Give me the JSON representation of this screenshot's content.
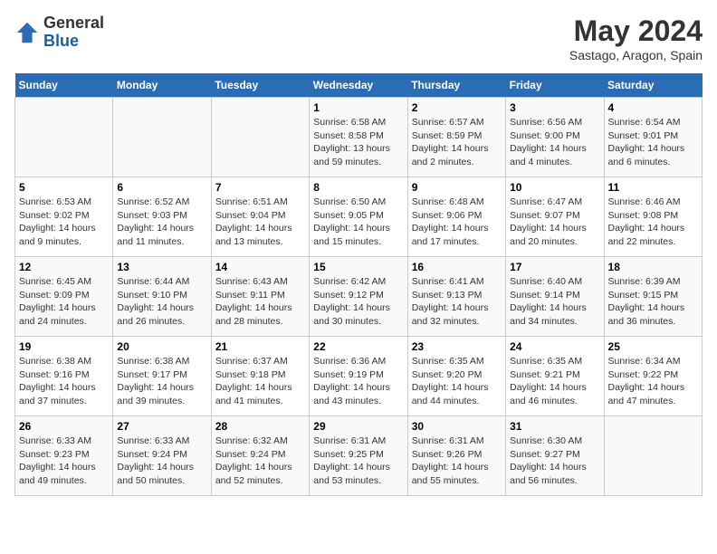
{
  "header": {
    "logo_line1": "General",
    "logo_line2": "Blue",
    "month": "May 2024",
    "location": "Sastago, Aragon, Spain"
  },
  "weekdays": [
    "Sunday",
    "Monday",
    "Tuesday",
    "Wednesday",
    "Thursday",
    "Friday",
    "Saturday"
  ],
  "weeks": [
    [
      {
        "day": "",
        "content": ""
      },
      {
        "day": "",
        "content": ""
      },
      {
        "day": "",
        "content": ""
      },
      {
        "day": "1",
        "content": "Sunrise: 6:58 AM\nSunset: 8:58 PM\nDaylight: 13 hours and 59 minutes."
      },
      {
        "day": "2",
        "content": "Sunrise: 6:57 AM\nSunset: 8:59 PM\nDaylight: 14 hours and 2 minutes."
      },
      {
        "day": "3",
        "content": "Sunrise: 6:56 AM\nSunset: 9:00 PM\nDaylight: 14 hours and 4 minutes."
      },
      {
        "day": "4",
        "content": "Sunrise: 6:54 AM\nSunset: 9:01 PM\nDaylight: 14 hours and 6 minutes."
      }
    ],
    [
      {
        "day": "5",
        "content": "Sunrise: 6:53 AM\nSunset: 9:02 PM\nDaylight: 14 hours and 9 minutes."
      },
      {
        "day": "6",
        "content": "Sunrise: 6:52 AM\nSunset: 9:03 PM\nDaylight: 14 hours and 11 minutes."
      },
      {
        "day": "7",
        "content": "Sunrise: 6:51 AM\nSunset: 9:04 PM\nDaylight: 14 hours and 13 minutes."
      },
      {
        "day": "8",
        "content": "Sunrise: 6:50 AM\nSunset: 9:05 PM\nDaylight: 14 hours and 15 minutes."
      },
      {
        "day": "9",
        "content": "Sunrise: 6:48 AM\nSunset: 9:06 PM\nDaylight: 14 hours and 17 minutes."
      },
      {
        "day": "10",
        "content": "Sunrise: 6:47 AM\nSunset: 9:07 PM\nDaylight: 14 hours and 20 minutes."
      },
      {
        "day": "11",
        "content": "Sunrise: 6:46 AM\nSunset: 9:08 PM\nDaylight: 14 hours and 22 minutes."
      }
    ],
    [
      {
        "day": "12",
        "content": "Sunrise: 6:45 AM\nSunset: 9:09 PM\nDaylight: 14 hours and 24 minutes."
      },
      {
        "day": "13",
        "content": "Sunrise: 6:44 AM\nSunset: 9:10 PM\nDaylight: 14 hours and 26 minutes."
      },
      {
        "day": "14",
        "content": "Sunrise: 6:43 AM\nSunset: 9:11 PM\nDaylight: 14 hours and 28 minutes."
      },
      {
        "day": "15",
        "content": "Sunrise: 6:42 AM\nSunset: 9:12 PM\nDaylight: 14 hours and 30 minutes."
      },
      {
        "day": "16",
        "content": "Sunrise: 6:41 AM\nSunset: 9:13 PM\nDaylight: 14 hours and 32 minutes."
      },
      {
        "day": "17",
        "content": "Sunrise: 6:40 AM\nSunset: 9:14 PM\nDaylight: 14 hours and 34 minutes."
      },
      {
        "day": "18",
        "content": "Sunrise: 6:39 AM\nSunset: 9:15 PM\nDaylight: 14 hours and 36 minutes."
      }
    ],
    [
      {
        "day": "19",
        "content": "Sunrise: 6:38 AM\nSunset: 9:16 PM\nDaylight: 14 hours and 37 minutes."
      },
      {
        "day": "20",
        "content": "Sunrise: 6:38 AM\nSunset: 9:17 PM\nDaylight: 14 hours and 39 minutes."
      },
      {
        "day": "21",
        "content": "Sunrise: 6:37 AM\nSunset: 9:18 PM\nDaylight: 14 hours and 41 minutes."
      },
      {
        "day": "22",
        "content": "Sunrise: 6:36 AM\nSunset: 9:19 PM\nDaylight: 14 hours and 43 minutes."
      },
      {
        "day": "23",
        "content": "Sunrise: 6:35 AM\nSunset: 9:20 PM\nDaylight: 14 hours and 44 minutes."
      },
      {
        "day": "24",
        "content": "Sunrise: 6:35 AM\nSunset: 9:21 PM\nDaylight: 14 hours and 46 minutes."
      },
      {
        "day": "25",
        "content": "Sunrise: 6:34 AM\nSunset: 9:22 PM\nDaylight: 14 hours and 47 minutes."
      }
    ],
    [
      {
        "day": "26",
        "content": "Sunrise: 6:33 AM\nSunset: 9:23 PM\nDaylight: 14 hours and 49 minutes."
      },
      {
        "day": "27",
        "content": "Sunrise: 6:33 AM\nSunset: 9:24 PM\nDaylight: 14 hours and 50 minutes."
      },
      {
        "day": "28",
        "content": "Sunrise: 6:32 AM\nSunset: 9:24 PM\nDaylight: 14 hours and 52 minutes."
      },
      {
        "day": "29",
        "content": "Sunrise: 6:31 AM\nSunset: 9:25 PM\nDaylight: 14 hours and 53 minutes."
      },
      {
        "day": "30",
        "content": "Sunrise: 6:31 AM\nSunset: 9:26 PM\nDaylight: 14 hours and 55 minutes."
      },
      {
        "day": "31",
        "content": "Sunrise: 6:30 AM\nSunset: 9:27 PM\nDaylight: 14 hours and 56 minutes."
      },
      {
        "day": "",
        "content": ""
      }
    ]
  ]
}
